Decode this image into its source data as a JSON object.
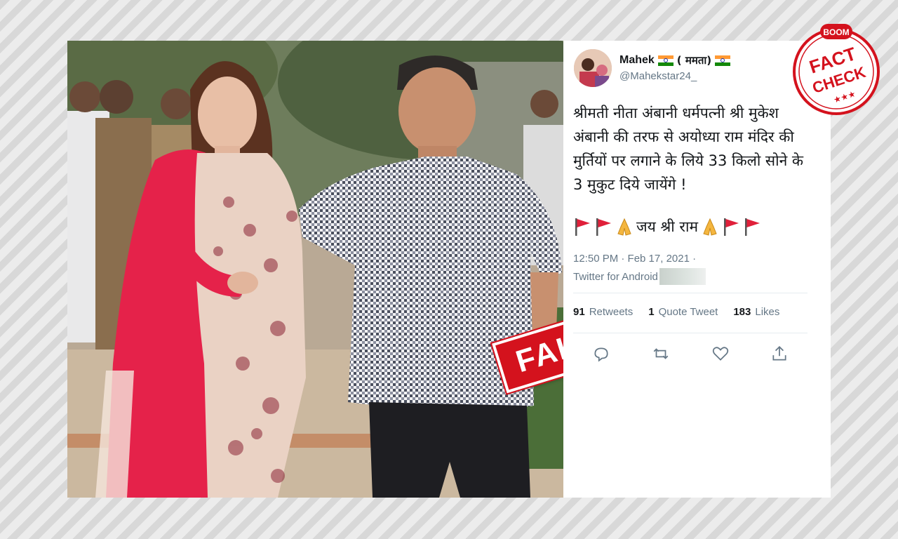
{
  "tweet": {
    "author_name": "Mahek",
    "author_name_suffix": "( ममता)",
    "handle": "@Mahekstar24_",
    "text": "श्रीमती नीता अंबानी धर्मपत्नी श्री मुकेश अंबानी की तरफ से अयोध्या राम मंदिर की मुर्तियों पर लगाने के लिये 33 किलो सोने के 3 मुकुट दिये जायेंगे !",
    "emoji_text": "जय श्री राम",
    "timestamp": "12:50 PM · Feb 17, 2021 ·",
    "source": "Twitter for Android",
    "stats": {
      "retweets_count": "91",
      "retweets_label": "Retweets",
      "quote_count": "1",
      "quote_label": "Quote Tweet",
      "likes_count": "183",
      "likes_label": "Likes"
    }
  },
  "stamp": {
    "label": "FAKE"
  },
  "badge": {
    "brand": "BOOM",
    "line1": "FACT",
    "line2": "CHECK",
    "stars": "★★★"
  },
  "colors": {
    "stamp_red": "#d4121d",
    "flag_saffron": "#ff9933",
    "flag_green": "#138808",
    "text_gray": "#657786"
  },
  "icons": [
    "reply-icon",
    "retweet-icon",
    "like-icon",
    "share-icon",
    "flag-emoji",
    "pray-emoji"
  ]
}
